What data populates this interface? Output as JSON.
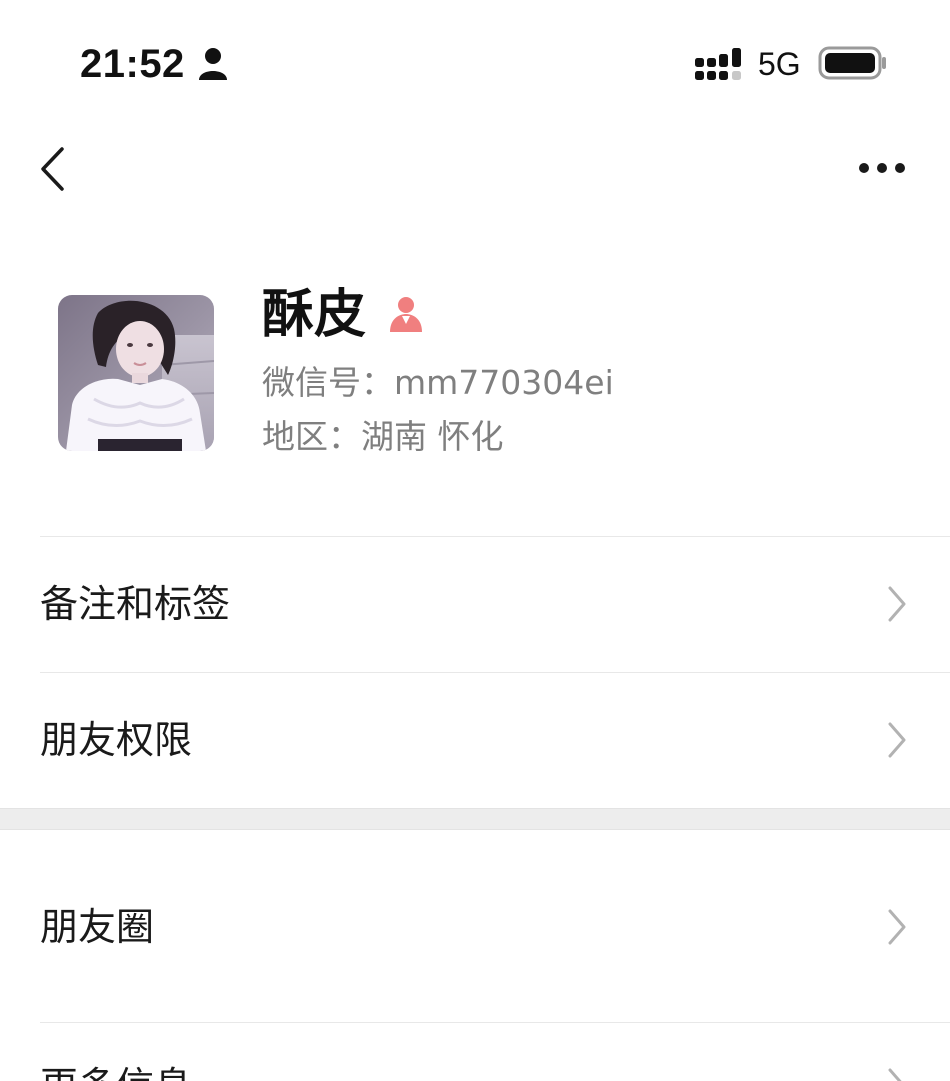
{
  "status_bar": {
    "time": "21:52",
    "person_icon": "person-icon",
    "signal_icon": "signal-icon",
    "network": "5G",
    "battery_icon": "battery-icon"
  },
  "nav": {
    "back_icon": "chevron-left-icon",
    "more_icon": "more-dots-icon"
  },
  "profile": {
    "name": "酥皮",
    "gender_icon": "female-icon",
    "gender_color": "#f07f7f",
    "wechat_id": "微信号：mm770304ei",
    "region": "地区：湖南 怀化"
  },
  "rows": [
    {
      "label": "备注和标签"
    },
    {
      "label": "朋友权限"
    },
    {
      "label": "朋友圈"
    },
    {
      "label": "更多信息"
    }
  ],
  "colors": {
    "text_primary": "#191919",
    "text_secondary": "#7f7f7f",
    "divider": "#e8e8e8",
    "section_gap": "#ededed",
    "chevron": "#b2b2b2"
  }
}
